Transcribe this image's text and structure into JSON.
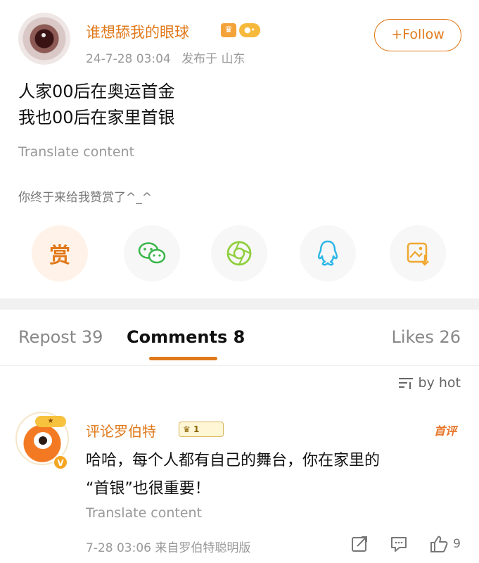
{
  "post": {
    "author": "谁想舔我的眼球",
    "timestamp": "24-7-28 03:04",
    "location": "发布于 山东",
    "follow_label": "+Follow",
    "lines": [
      "人家00后在奥运首金",
      "我也00后在家里首银"
    ],
    "translate_label": "Translate content",
    "reward_text": "你终于来给我赞赏了^_^"
  },
  "share": {
    "reward_label": "赏",
    "icons": [
      "reward-icon",
      "wechat-icon",
      "moments-icon",
      "qq-icon",
      "save-image-icon"
    ]
  },
  "tabs": [
    {
      "label": "Repost 39",
      "active": false
    },
    {
      "label": "Comments 8",
      "active": true
    },
    {
      "label": "Likes 26",
      "active": false
    }
  ],
  "sort": {
    "label": "by hot"
  },
  "comment": {
    "author": "评论罗伯特",
    "level": "1",
    "first_tag": "首评",
    "lines": [
      "哈哈，每个人都有自己的舞台，你在家里的",
      "“首银”也很重要！"
    ],
    "translate_label": "Translate content",
    "time_source": "7-28 03:06  来自罗伯特聪明版",
    "like_count": "9"
  },
  "colors": {
    "accent": "#e0791b",
    "muted": "#999999"
  }
}
